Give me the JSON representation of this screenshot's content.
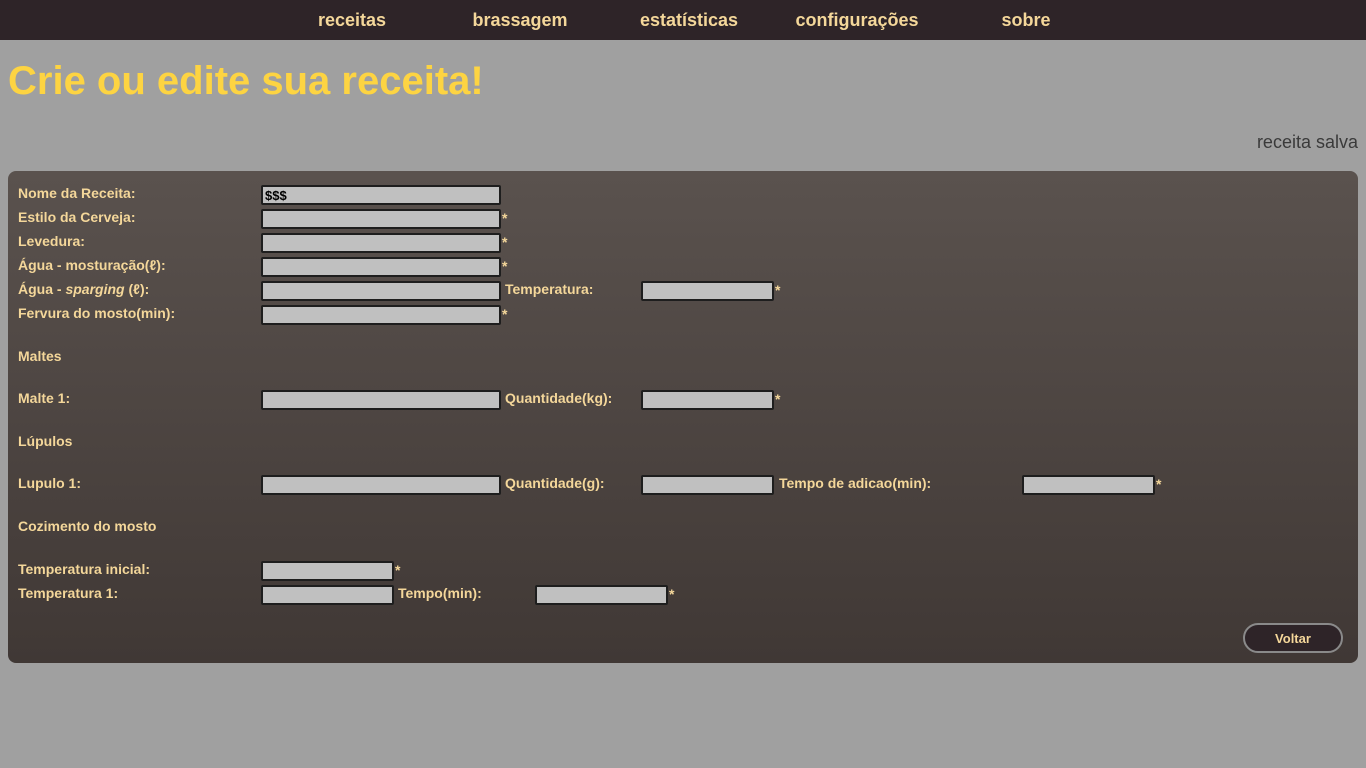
{
  "nav": {
    "items": [
      {
        "label": "receitas"
      },
      {
        "label": "brassagem"
      },
      {
        "label": "estatísticas"
      },
      {
        "label": "configurações"
      },
      {
        "label": "sobre"
      }
    ]
  },
  "header": {
    "title": "Crie ou edite sua receita!",
    "status": "receita salva"
  },
  "form": {
    "nome": {
      "label": "Nome da Receita:",
      "value": "$$$"
    },
    "estilo": {
      "label": "Estilo da Cerveja:",
      "value": ""
    },
    "levedura": {
      "label": "Levedura:",
      "value": ""
    },
    "agua_mostura": {
      "label": "Água - mosturação(ℓ):",
      "value": ""
    },
    "agua_sparging": {
      "label_prefix": "Água - ",
      "label_em": "sparging",
      "label_suffix": " (ℓ):",
      "value": ""
    },
    "temperatura": {
      "label": "Temperatura:",
      "value": ""
    },
    "fervura": {
      "label": "Fervura do mosto(min):",
      "value": ""
    },
    "required_mark": "*"
  },
  "maltes": {
    "section": "Maltes",
    "malte1": {
      "label": "Malte 1:",
      "value": ""
    },
    "quantidade": {
      "label": "Quantidade(kg):",
      "value": ""
    }
  },
  "lupulos": {
    "section": "Lúpulos",
    "lupulo1": {
      "label": "Lupulo 1:",
      "value": ""
    },
    "quantidade": {
      "label": "Quantidade(g):",
      "value": ""
    },
    "tempo_adicao": {
      "label": "Tempo de adicao(min):",
      "value": ""
    }
  },
  "cozimento": {
    "section": "Cozimento do mosto",
    "temp_inicial": {
      "label": "Temperatura inicial:",
      "value": ""
    },
    "temp1": {
      "label": "Temperatura 1:",
      "value": ""
    },
    "tempo": {
      "label": "Tempo(min):",
      "value": ""
    }
  },
  "actions": {
    "voltar": "Voltar"
  },
  "colors": {
    "nav_bg": "#2e2428",
    "nav_text": "#f4d79a",
    "title": "#fdd442",
    "page_bg": "#a0a0a0",
    "panel_bg": "#4d4542",
    "label": "#f4d79a",
    "input_bg": "#c0c0c0"
  }
}
